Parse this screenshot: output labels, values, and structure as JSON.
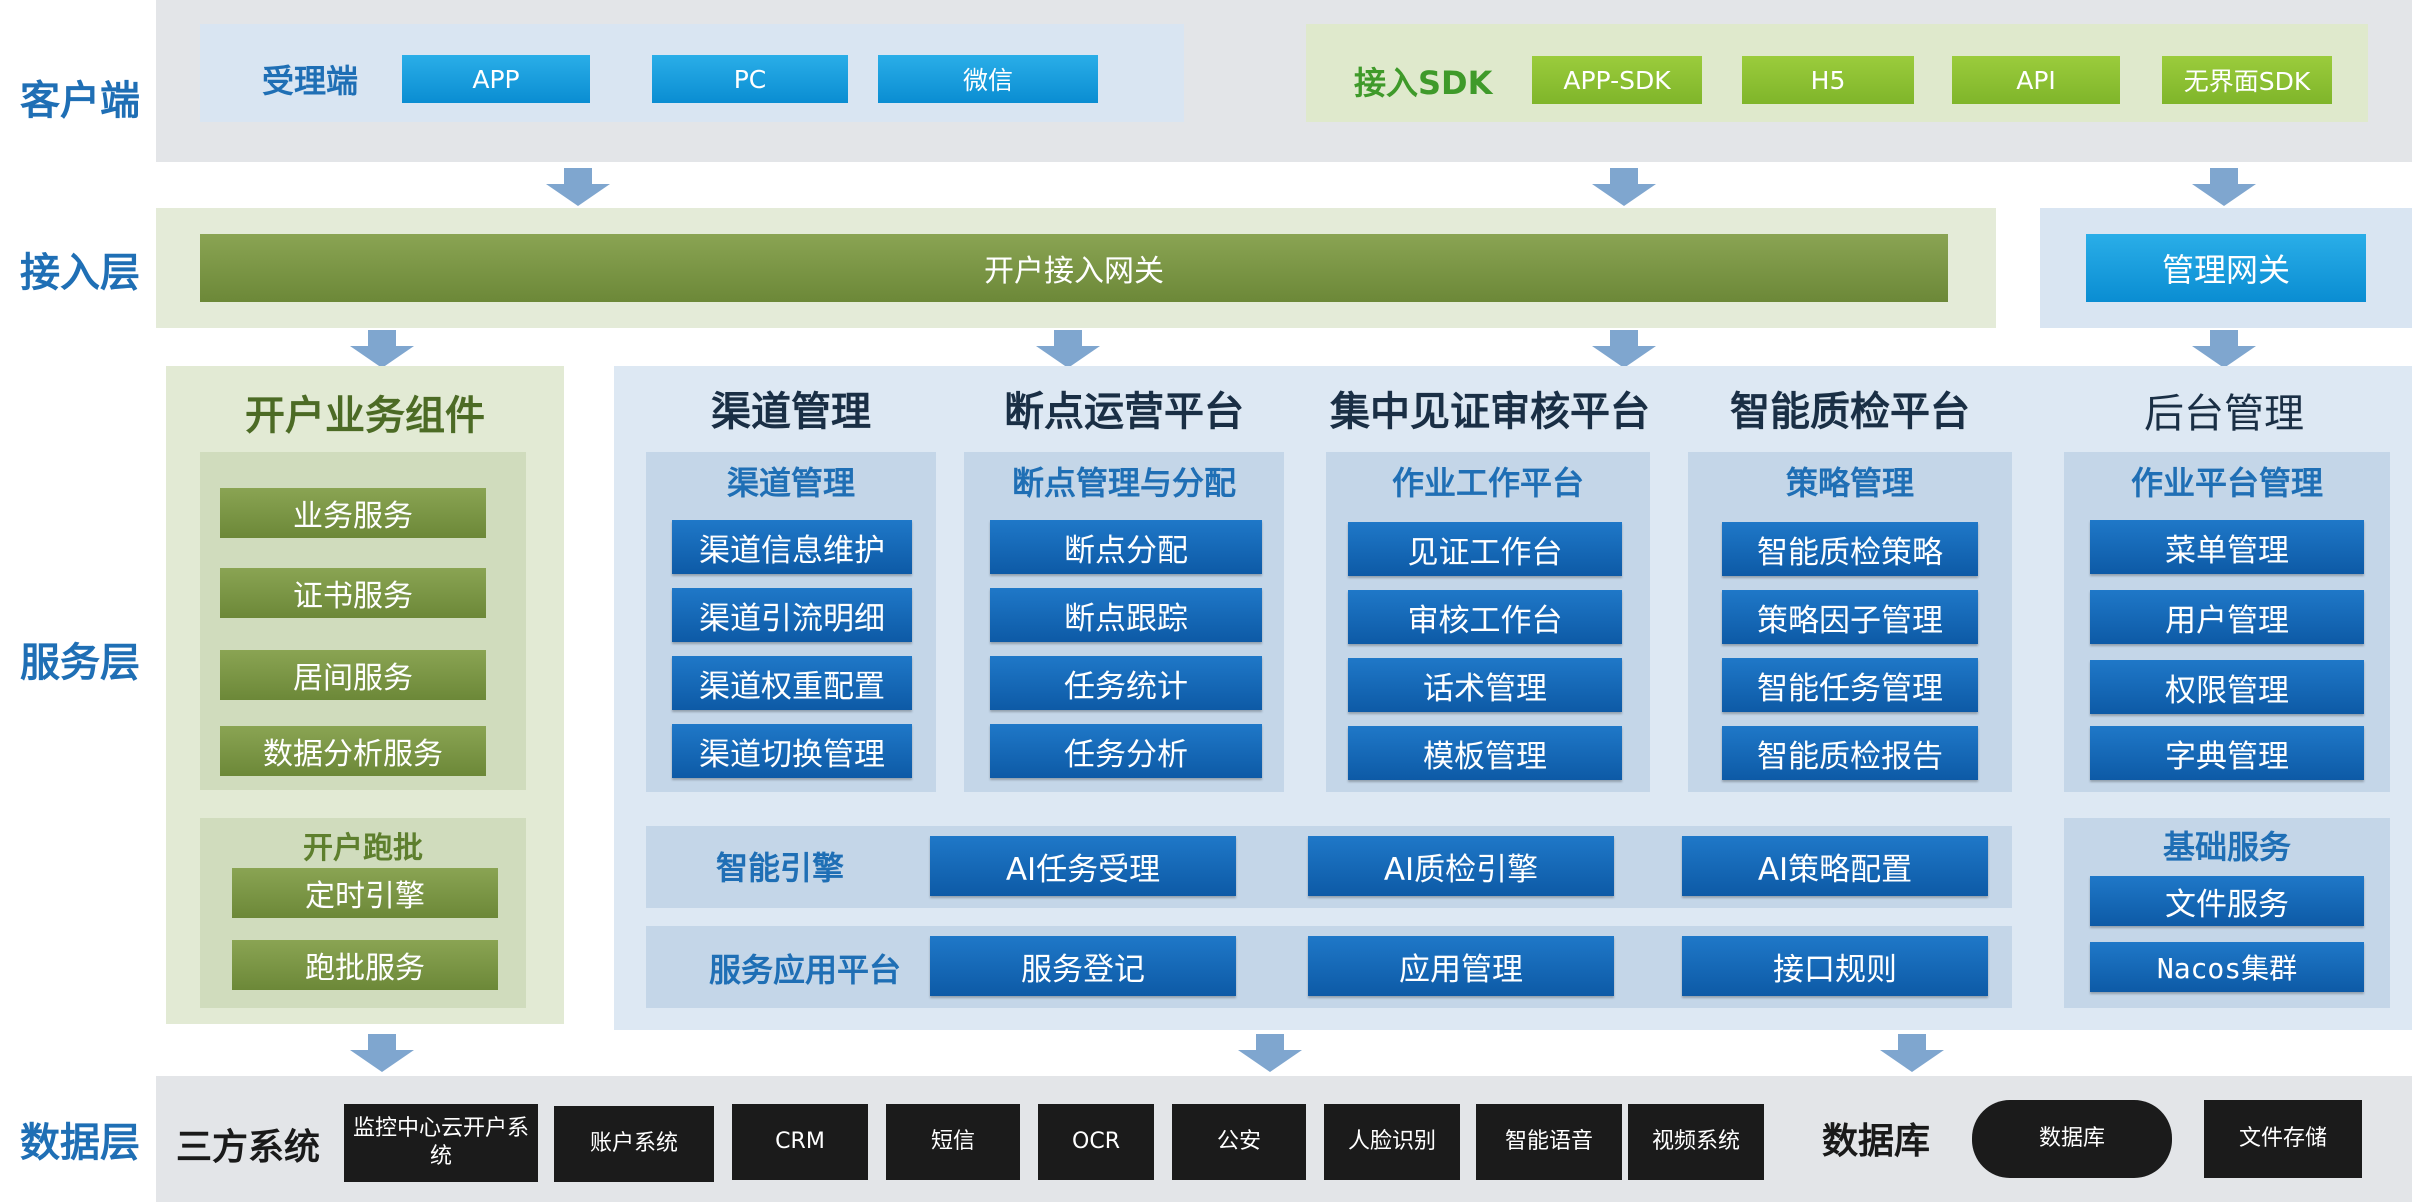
{
  "colors": {
    "layer_label": "#1f6fb5",
    "cyan_button": "#0a8dd2",
    "lime_button": "#8cc232",
    "olive_gateway": "#6f8a3a",
    "dark_blue_button": "#0d5aa6",
    "black_button": "#1b1b1b",
    "arrow": "#7fa6cf"
  },
  "layers": {
    "client": "客户端",
    "access": "接入层",
    "service": "服务层",
    "data": "数据层"
  },
  "client": {
    "left_label": "受理端",
    "left_buttons": [
      "APP",
      "PC",
      "微信"
    ],
    "right_label": "接入SDK",
    "right_buttons": [
      "APP-SDK",
      "H5",
      "API",
      "无界面SDK"
    ]
  },
  "access": {
    "gateway": "开户接入网关",
    "mgmt_gateway": "管理网关"
  },
  "service": {
    "components": {
      "title": "开户业务组件",
      "items": [
        "业务服务",
        "证书服务",
        "居间服务",
        "数据分析服务"
      ],
      "batch_title": "开户跑批",
      "batch_items": [
        "定时引擎",
        "跑批服务"
      ]
    },
    "columns": [
      {
        "title": "渠道管理",
        "sub": "渠道管理",
        "items": [
          "渠道信息维护",
          "渠道引流明细",
          "渠道权重配置",
          "渠道切换管理"
        ]
      },
      {
        "title": "断点运营平台",
        "sub": "断点管理与分配",
        "items": [
          "断点分配",
          "断点跟踪",
          "任务统计",
          "任务分析"
        ]
      },
      {
        "title": "集中见证审核平台",
        "sub": "作业工作平台",
        "items": [
          "见证工作台",
          "审核工作台",
          "话术管理",
          "模板管理"
        ]
      },
      {
        "title": "智能质检平台",
        "sub": "策略管理",
        "items": [
          "智能质检策略",
          "策略因子管理",
          "智能任务管理",
          "智能质检报告"
        ]
      }
    ],
    "ai_engine": {
      "label": "智能引擎",
      "items": [
        "AI任务受理",
        "AI质检引擎",
        "AI策略配置"
      ]
    },
    "app_platform": {
      "label": "服务应用平台",
      "items": [
        "服务登记",
        "应用管理",
        "接口规则"
      ]
    },
    "backend": {
      "title": "后台管理",
      "sub": "作业平台管理",
      "items": [
        "菜单管理",
        "用户管理",
        "权限管理",
        "字典管理"
      ],
      "basic_title": "基础服务",
      "basic_items": [
        "文件服务",
        "Nacos集群"
      ]
    }
  },
  "data_layer": {
    "third_party_label": "三方系统",
    "third_party_items": [
      "监控中心云开户系统",
      "账户系统",
      "CRM",
      "短信",
      "OCR",
      "公安",
      "人脸识别",
      "智能语音",
      "视频系统"
    ],
    "db_label": "数据库",
    "db_items": [
      "数据库",
      "文件存储"
    ]
  }
}
